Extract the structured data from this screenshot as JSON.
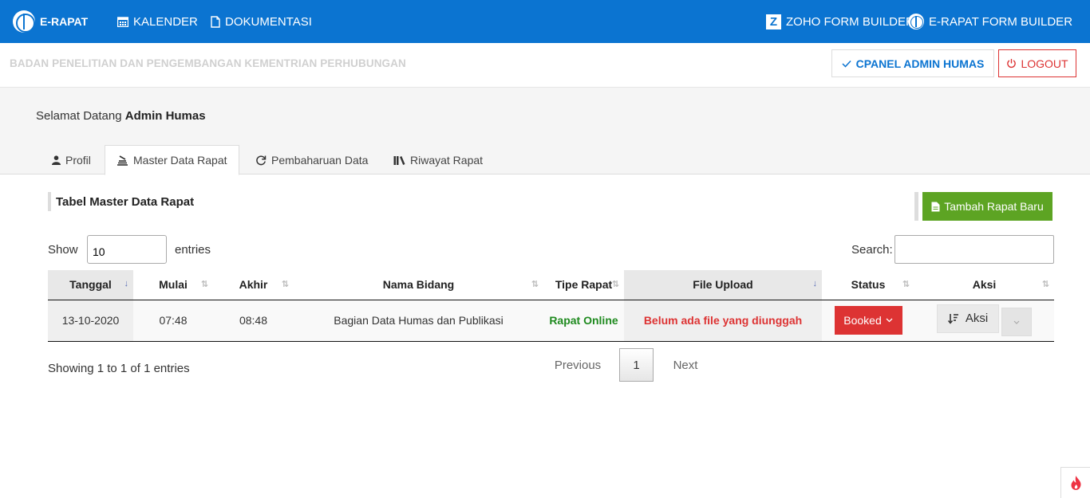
{
  "nav": {
    "brand": "E-RAPAT",
    "kalender": "KALENDER",
    "dokumentasi": "DOKUMENTASI",
    "zoho": "ZOHO FORM BUILDER",
    "erapat_form": "E-RAPAT FORM BUILDER",
    "zoho_letter": "Z"
  },
  "subheader": {
    "agency": "BADAN PENELITIAN DAN PENGEMBANGAN KEMENTRIAN PERHUBUNGAN",
    "cpanel": "CPANEL ADMIN HUMAS",
    "logout": "LOGOUT"
  },
  "welcome": {
    "prefix": "Selamat Datang ",
    "name": "Admin Humas"
  },
  "tabs": [
    {
      "label": "Profil"
    },
    {
      "label": "Master Data Rapat"
    },
    {
      "label": "Pembaharuan Data"
    },
    {
      "label": "Riwayat Rapat"
    }
  ],
  "section": {
    "title": "Tabel Master Data Rapat",
    "add_button": "Tambah Rapat Baru"
  },
  "controls": {
    "show": "Show",
    "entries_value": "10",
    "entries": "entries",
    "search": "Search:"
  },
  "table": {
    "headers": [
      "Tanggal",
      "Mulai",
      "Akhir",
      "Nama Bidang",
      "Tipe Rapat",
      "File Upload",
      "Status",
      "Aksi"
    ],
    "rows": [
      {
        "tanggal": "13-10-2020",
        "mulai": "07:48",
        "akhir": "08:48",
        "bidang": "Bagian Data Humas dan Publikasi",
        "tipe": "Rapat Online",
        "file": "Belum ada file yang diunggah",
        "status": "Booked",
        "aksi": "Aksi"
      }
    ]
  },
  "pagination": {
    "info": "Showing 1 to 1 of 1 entries",
    "previous": "Previous",
    "current": "1",
    "next": "Next"
  },
  "colors": {
    "nav_blue": "#0b74d1",
    "add_green": "#5da423",
    "booked_red": "#dd3333",
    "online_green": "#1f8a1f"
  }
}
